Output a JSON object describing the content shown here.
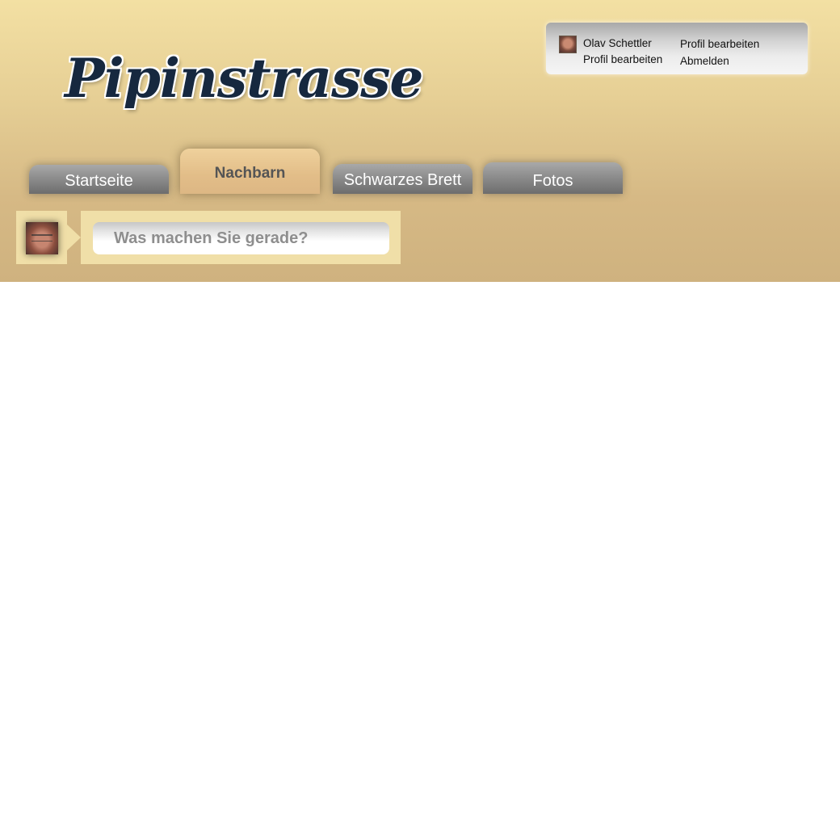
{
  "site": {
    "logo": "Pipinstrasse"
  },
  "userbox": {
    "name": "Olav Schettler",
    "edit_profile_1": "Profil bearbeiten",
    "edit_profile_2": "Profil bearbeiten",
    "logout": "Abmelden"
  },
  "tabs": [
    {
      "label": "Startseite",
      "active": false
    },
    {
      "label": "Nachbarn",
      "active": true
    },
    {
      "label": "Schwarzes Brett",
      "active": false
    },
    {
      "label": "Fotos",
      "active": false
    }
  ],
  "status": {
    "placeholder": "Was machen Sie gerade?"
  },
  "colors": {
    "header_top": "#f3e0a3",
    "header_bottom": "#cfb27f",
    "logo": "#16283f",
    "active_tab": "#e2bd88",
    "inactive_tab": "#8d8d8d"
  }
}
